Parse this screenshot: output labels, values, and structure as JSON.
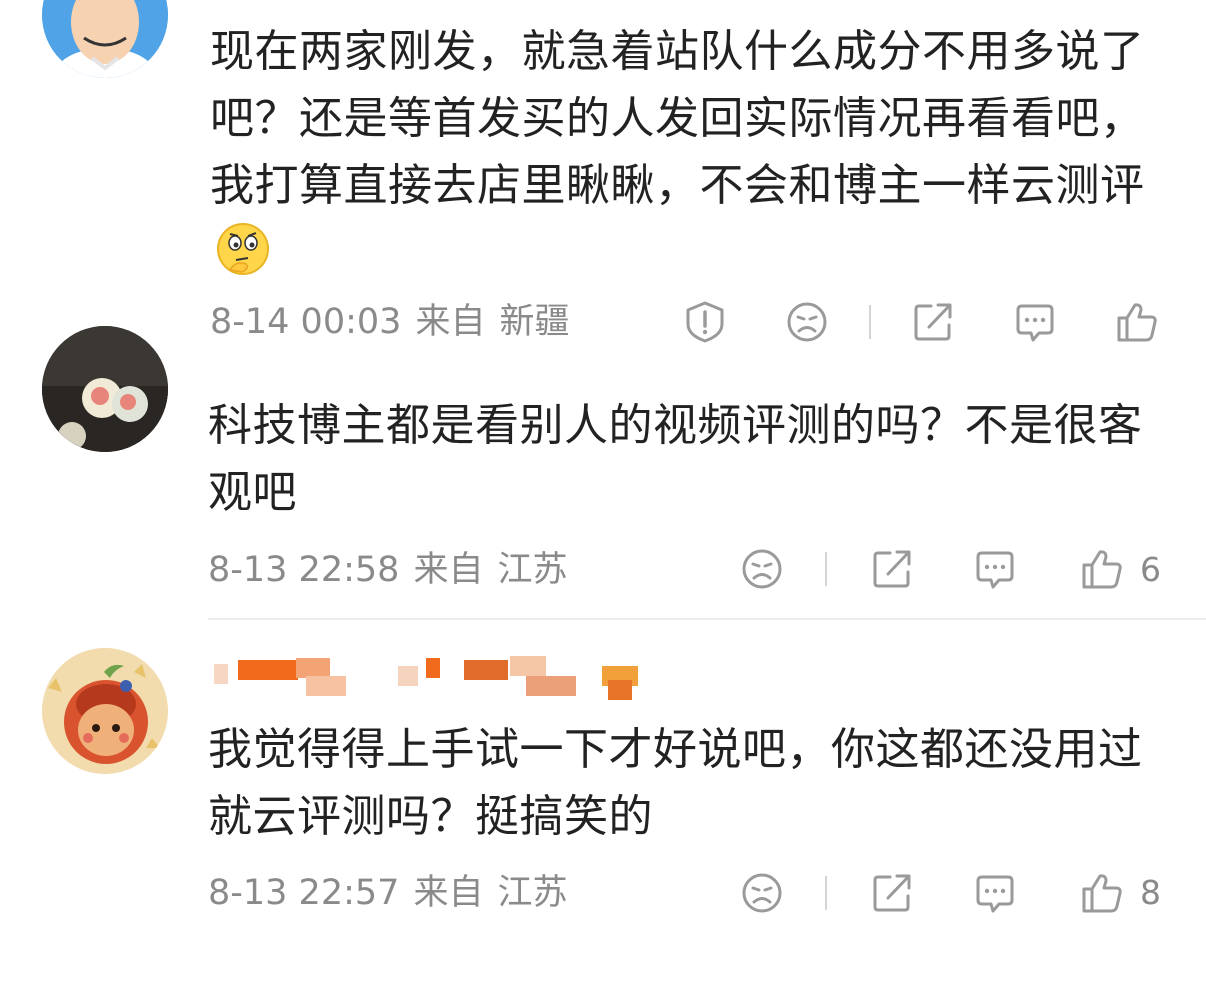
{
  "comments": [
    {
      "text": "现在两家刚发，就急着站队什么成分不用多说了吧？还是等首发买的人发回实际情况再看看吧，我打算直接去店里瞅瞅，不会和博主一样云测评",
      "emoji": "thinking-emoji",
      "time": "8-14 00:03",
      "from_label": "来自",
      "location": "新疆",
      "likes": ""
    },
    {
      "text": "科技博主都是看别人的视频评测的吗？不是很客观吧",
      "time": "8-13 22:58",
      "from_label": "来自",
      "location": "江苏",
      "likes": "6"
    },
    {
      "username_hidden": true,
      "text": "我觉得得上手试一下才好说吧，你这都还没用过就云评测吗？挺搞笑的",
      "time": "8-13 22:57",
      "from_label": "来自",
      "location": "江苏",
      "likes": "8"
    }
  ],
  "icons": {
    "report": "report-icon",
    "dislike": "sad-face-icon",
    "share": "share-icon",
    "reply": "comment-icon",
    "like": "thumbs-up-icon"
  },
  "colors": {
    "text": "#222222",
    "meta": "#8a8a8a",
    "icon": "#9a9a9a",
    "divider": "#ececec"
  }
}
